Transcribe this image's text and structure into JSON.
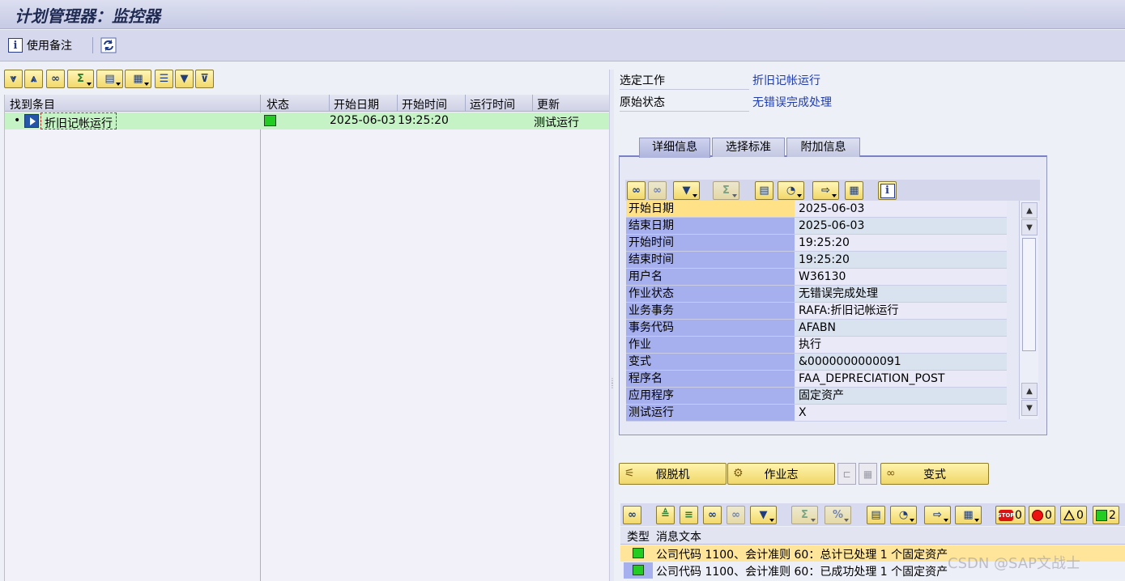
{
  "window": {
    "title": "计划管理器：监控器"
  },
  "app_toolbar": {
    "notes_label": "使用备注"
  },
  "left_panel": {
    "columns": [
      "找到条目",
      "状态",
      "开始日期",
      "开始时间",
      "运行时间",
      "更新"
    ],
    "row": {
      "name": "折旧记帐运行",
      "start_date": "2025-06-03",
      "start_time": "19:25:20",
      "runtime": "",
      "update": "测试运行"
    }
  },
  "right_panel": {
    "selected_job_label": "选定工作",
    "selected_job_value": "折旧记帐运行",
    "orig_status_label": "原始状态",
    "orig_status_value": "无错误完成处理",
    "tabs": [
      "详细信息",
      "选择标准",
      "附加信息"
    ],
    "details": [
      {
        "k": "开始日期",
        "v": "2025-06-03"
      },
      {
        "k": "结束日期",
        "v": "2025-06-03"
      },
      {
        "k": "开始时间",
        "v": "19:25:20"
      },
      {
        "k": "结束时间",
        "v": "19:25:20"
      },
      {
        "k": "用户名",
        "v": "W36130"
      },
      {
        "k": "作业状态",
        "v": "无错误完成处理"
      },
      {
        "k": "业务事务",
        "v": "RAFA:折旧记帐运行"
      },
      {
        "k": "事务代码",
        "v": "AFABN"
      },
      {
        "k": "作业",
        "v": "执行"
      },
      {
        "k": "变式",
        "v": "&0000000000091"
      },
      {
        "k": "程序名",
        "v": "FAA_DEPRECIATION_POST"
      },
      {
        "k": "应用程序",
        "v": "固定资产"
      },
      {
        "k": "测试运行",
        "v": "X"
      }
    ],
    "buttons": {
      "spool": "假脱机",
      "job_log": "作业志",
      "variant": "变式"
    }
  },
  "messages": {
    "counters": {
      "stop": "0",
      "error": "0",
      "warning": "0",
      "success": "2"
    },
    "header": {
      "type": "类型",
      "text": "消息文本"
    },
    "rows": [
      {
        "text": "公司代码 1100、会计准则 60：总计已处理 1 个固定资产"
      },
      {
        "text": "公司代码 1100、会计准则 60：已成功处理 1 个固定资产"
      }
    ]
  },
  "watermark": "CSDN @SAP文战士",
  "icons": {
    "info": "info-icon",
    "refresh": "refresh-icon",
    "expand": "expand-all-icon",
    "collapse": "collapse-all-icon",
    "find": "binoculars-icon",
    "sum": "sum-icon",
    "print": "print-icon",
    "layout": "layout-icon",
    "filter": "filter-icon"
  }
}
